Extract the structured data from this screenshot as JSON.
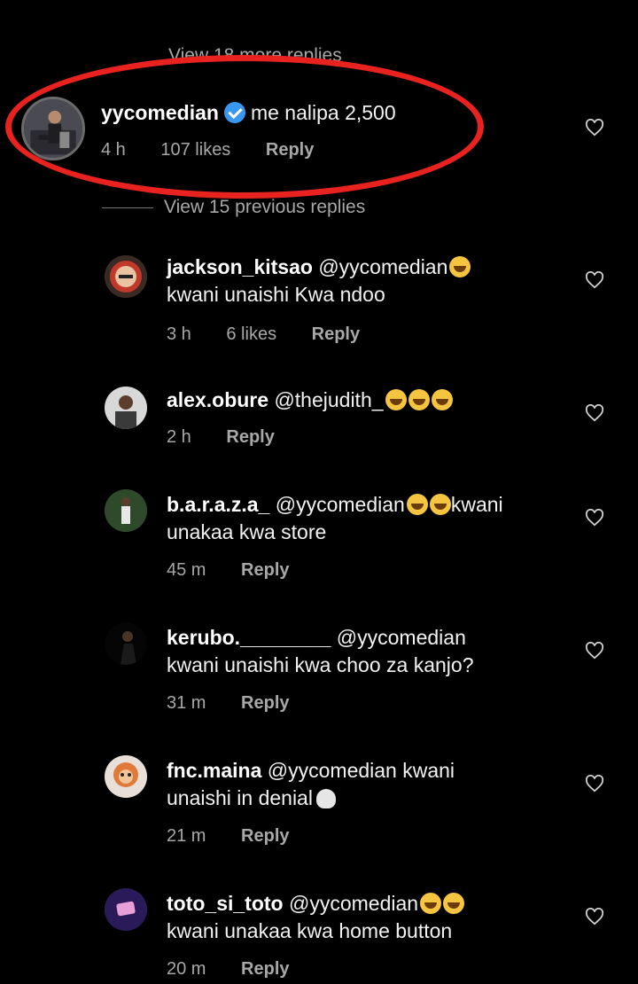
{
  "view_more_replies": "View 18 more replies",
  "top_comment": {
    "username": "yycomedian",
    "text": "me nalipa 2,500",
    "time": "4 h",
    "likes": "107 likes",
    "reply": "Reply"
  },
  "view_previous": "View 15 previous replies",
  "replies": [
    {
      "username": "jackson_kitsao",
      "text1": "@yycomedian",
      "emojis": 1,
      "text2": "kwani unaishi Kwa ndoo",
      "time": "3 h",
      "likes": "6 likes",
      "reply": "Reply"
    },
    {
      "username": "alex.obure",
      "text1": "@thejudith_",
      "emojis": 3,
      "time": "2 h",
      "reply": "Reply"
    },
    {
      "username": "b.a.r.a.z.a_",
      "text1": "@yycomedian",
      "emojis": 2,
      "text1b": "kwani",
      "text2": "unakaa kwa store",
      "time": "45 m",
      "reply": "Reply"
    },
    {
      "username": "kerubo.________",
      "text1": "@yycomedian",
      "text2": "kwani unaishi kwa choo za kanjo?",
      "time": "31 m",
      "reply": "Reply"
    },
    {
      "username": "fnc.maina",
      "text1": "@yycomedian kwani",
      "text2": "unaishi in denial",
      "time": "21 m",
      "reply": "Reply"
    },
    {
      "username": "toto_si_toto",
      "text1": "@yycomedian",
      "emojis": 2,
      "text2": "kwani unakaa kwa home button",
      "time": "20 m",
      "reply": "Reply"
    }
  ],
  "icons": {
    "like": "heart-outline-icon",
    "verified": "verified-badge-icon"
  },
  "colors": {
    "background": "#000000",
    "highlight": "#e8231f",
    "verified": "#3897f0",
    "secondary_text": "#a8a8a8"
  }
}
